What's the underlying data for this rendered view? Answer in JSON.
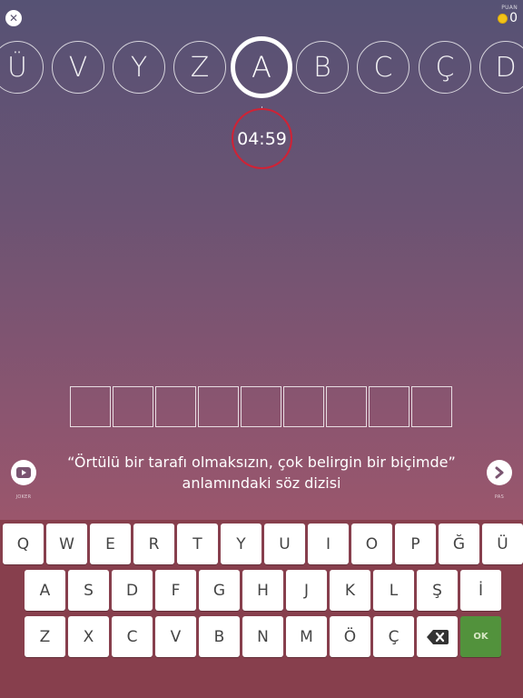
{
  "header": {
    "score_label": "PUAN",
    "score_value": "0",
    "coin_color": "#f2c318"
  },
  "letters": [
    {
      "char": "Ü",
      "active": false
    },
    {
      "char": "V",
      "active": false
    },
    {
      "char": "Y",
      "active": false
    },
    {
      "char": "Z",
      "active": false
    },
    {
      "char": "A",
      "active": true
    },
    {
      "char": "B",
      "active": false
    },
    {
      "char": "C",
      "active": false
    },
    {
      "char": "Ç",
      "active": false
    },
    {
      "char": "D",
      "active": false
    }
  ],
  "timer": {
    "value": "04:59",
    "ring_color": "#d02235"
  },
  "answer": {
    "length": 9
  },
  "clue": {
    "line1": "“Örtülü bir tarafı olmaksızın, çok belirgin bir biçimde”",
    "line2": "anlamındaki söz dizisi"
  },
  "joker": {
    "label": "JOKER",
    "icon": "video-play-icon"
  },
  "pass": {
    "label": "PAS",
    "icon": "chevron-right-icon"
  },
  "keyboard": {
    "rows": [
      [
        "Q",
        "W",
        "E",
        "R",
        "T",
        "Y",
        "U",
        "I",
        "O",
        "P",
        "Ğ",
        "Ü"
      ],
      [
        "A",
        "S",
        "D",
        "F",
        "G",
        "H",
        "J",
        "K",
        "L",
        "Ş",
        "İ"
      ],
      [
        "Z",
        "X",
        "C",
        "V",
        "B",
        "N",
        "M",
        "Ö",
        "Ç"
      ]
    ],
    "ok_label": "OK",
    "ok_color": "#52923c",
    "backspace_icon": "backspace-icon"
  }
}
